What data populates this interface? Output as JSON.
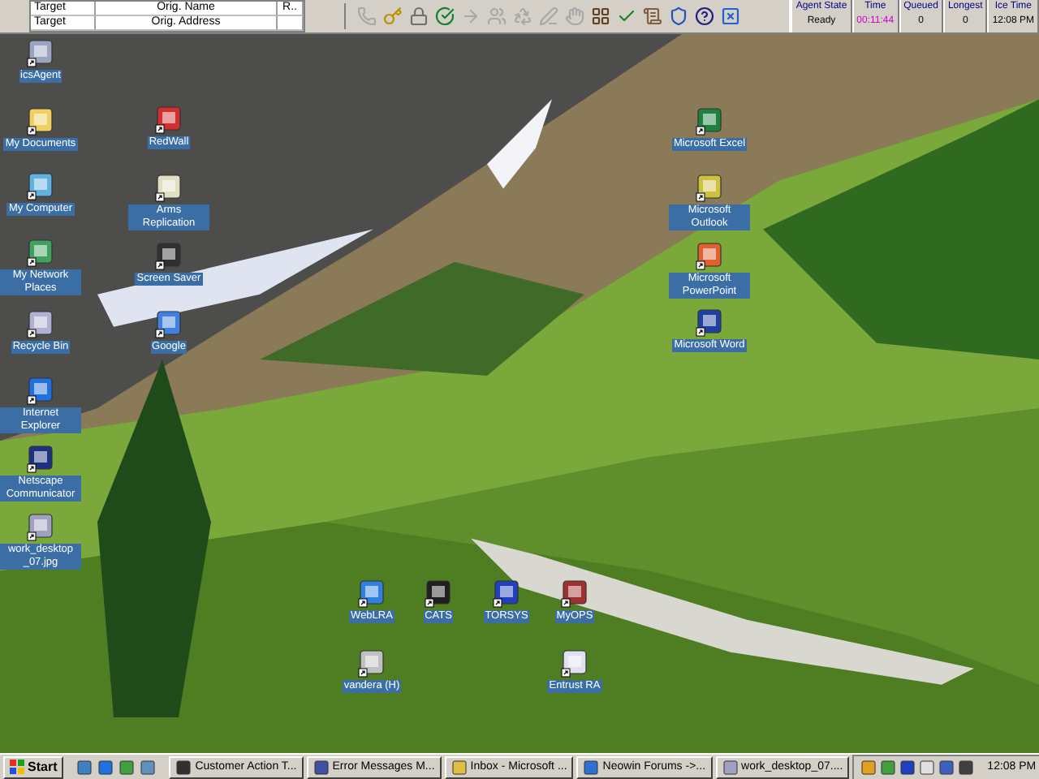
{
  "target_table": {
    "rows": [
      {
        "cells": [
          "Target",
          "Orig. Name",
          "R.."
        ]
      },
      {
        "cells": [
          "Target",
          "Orig. Address"
        ]
      }
    ]
  },
  "toolbar_buttons": [
    {
      "disabled": true
    },
    {
      "disabled": false
    },
    {
      "disabled": false
    },
    {
      "disabled": false
    },
    {
      "disabled": true
    },
    {
      "disabled": true
    },
    {
      "disabled": true
    },
    {
      "disabled": true
    },
    {
      "disabled": true
    },
    {
      "disabled": false
    },
    {
      "disabled": false
    },
    {
      "disabled": false
    },
    {
      "disabled": false
    },
    {
      "disabled": false
    },
    {
      "disabled": false
    }
  ],
  "agent_status": [
    {
      "label": "Agent State",
      "value": "Ready",
      "highlighted": false
    },
    {
      "label": "Time",
      "value": "00:11:44",
      "highlighted": true
    },
    {
      "label": "Queued",
      "value": "0",
      "highlighted": false
    },
    {
      "label": "Longest",
      "value": "0",
      "highlighted": false
    },
    {
      "label": "Ice Time",
      "value": "12:08 PM",
      "highlighted": false
    }
  ],
  "desktop_icons": [
    {
      "label": "icsAgent"
    },
    {
      "label": "My Documents"
    },
    {
      "label": "My Computer"
    },
    {
      "label": "My Network Places"
    },
    {
      "label": "Recycle Bin"
    },
    {
      "label": "Internet Explorer"
    },
    {
      "label": "Netscape Communicator"
    },
    {
      "label": "work_desktop _07.jpg"
    },
    {
      "label": "RedWall"
    },
    {
      "label": "Arms Replication"
    },
    {
      "label": "Screen Saver"
    },
    {
      "label": "Google"
    },
    {
      "label": "Microsoft Excel"
    },
    {
      "label": "Microsoft Outlook"
    },
    {
      "label": "Microsoft PowerPoint"
    },
    {
      "label": "Microsoft Word"
    },
    {
      "label": "WebLRA"
    },
    {
      "label": "CATS"
    },
    {
      "label": "TORSYS"
    },
    {
      "label": "MyOPS"
    },
    {
      "label": "vandera (H)"
    },
    {
      "label": "Entrust RA"
    }
  ],
  "taskbar": {
    "start": "Start",
    "tasks": [
      {
        "label": "Customer Action T..."
      },
      {
        "label": "Error Messages M..."
      },
      {
        "label": "Inbox - Microsoft ..."
      },
      {
        "label": "Neowin Forums ->..."
      },
      {
        "label": "work_desktop_07...."
      }
    ],
    "clock": "12:08 PM"
  }
}
